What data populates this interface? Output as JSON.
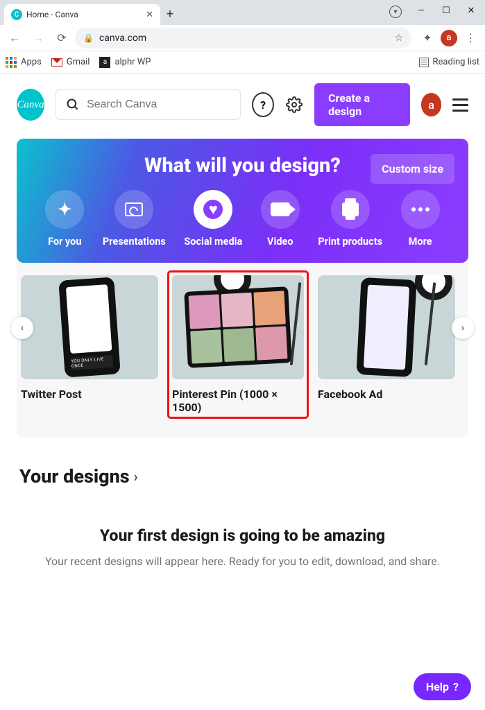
{
  "browser": {
    "tab_title": "Home - Canva",
    "url": "canva.com",
    "bookmarks": {
      "apps": "Apps",
      "gmail": "Gmail",
      "alphr": "alphr WP",
      "reading": "Reading list"
    },
    "avatar_letter": "a"
  },
  "header": {
    "logo_text": "Canva",
    "search_placeholder": "Search Canva",
    "create_label": "Create a design",
    "avatar_letter": "a"
  },
  "hero": {
    "title": "What will you design?",
    "custom_size": "Custom size",
    "categories": [
      {
        "label": "For you"
      },
      {
        "label": "Presentations"
      },
      {
        "label": "Social media",
        "active": true
      },
      {
        "label": "Video"
      },
      {
        "label": "Print products"
      },
      {
        "label": "More"
      }
    ]
  },
  "cards": [
    {
      "label": "Twitter Post"
    },
    {
      "label": "Pinterest Pin (1000 × 1500)",
      "highlight": true
    },
    {
      "label": "Facebook Ad"
    }
  ],
  "your_designs": {
    "heading": "Your designs",
    "empty_title": "Your first design is going to be amazing",
    "empty_sub": "Your recent designs will appear here. Ready for you to edit, download, and share."
  },
  "help_label": "Help"
}
